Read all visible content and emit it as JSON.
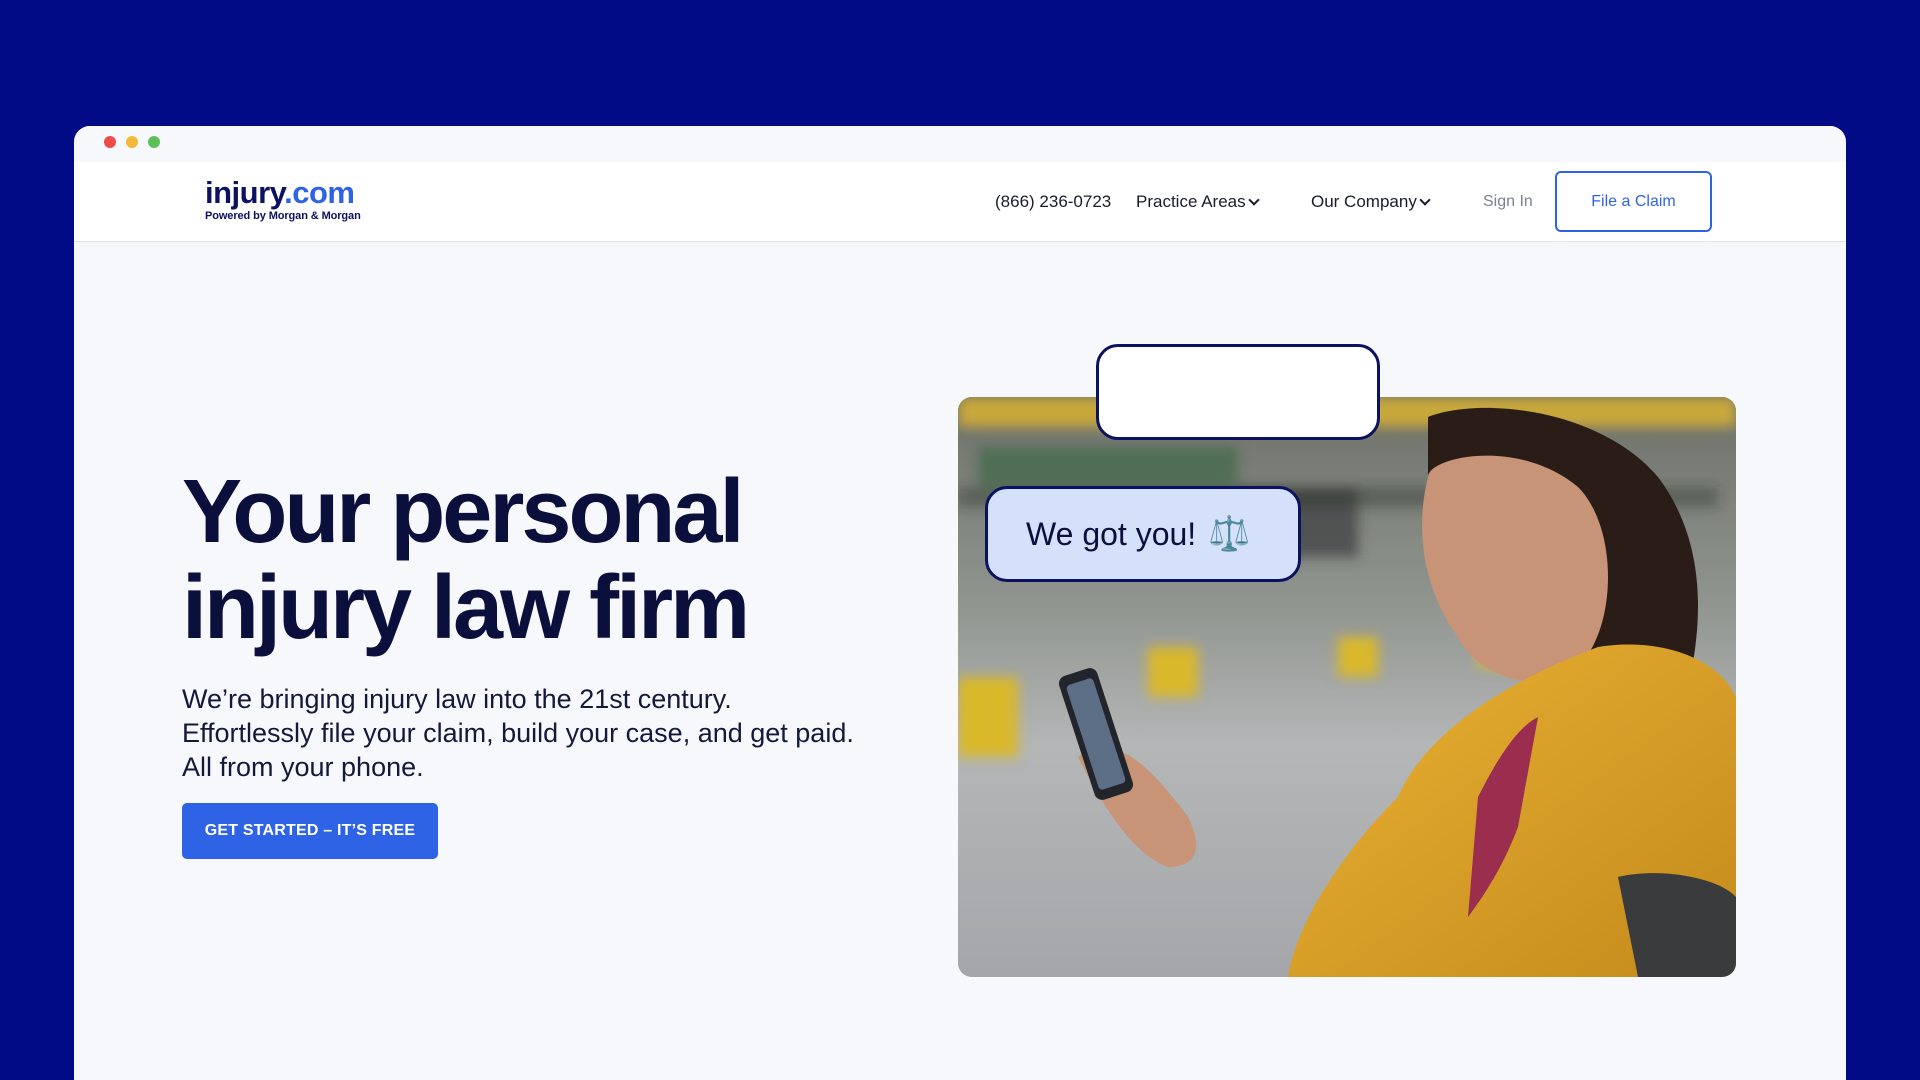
{
  "window": {
    "controls": [
      "close",
      "minimize",
      "maximize"
    ]
  },
  "brand": {
    "name_part1": "injury",
    "name_part2": ".com",
    "tagline": "Powered by Morgan & Morgan",
    "primary_color": "#2f63e6",
    "dark_color": "#0b1260"
  },
  "nav": {
    "phone": "(866) 236-0723",
    "practice_areas": "Practice Areas",
    "our_company": "Our Company",
    "sign_in": "Sign In",
    "file_claim": "File a Claim"
  },
  "hero": {
    "title_line1": "Your personal",
    "title_line2": "injury law firm",
    "subtitle": "We’re bringing injury law into the 21st century. Effortlessly file your claim, build your case, and get paid. All from your phone.",
    "cta": "GET STARTED – IT’S FREE"
  },
  "chat": {
    "top_bubble_text": "",
    "main_bubble_text": "We got you!",
    "main_bubble_icon": "scale-icon",
    "main_bubble_glyph": "⚖️"
  },
  "image": {
    "subject": "woman-using-phone-photo"
  }
}
